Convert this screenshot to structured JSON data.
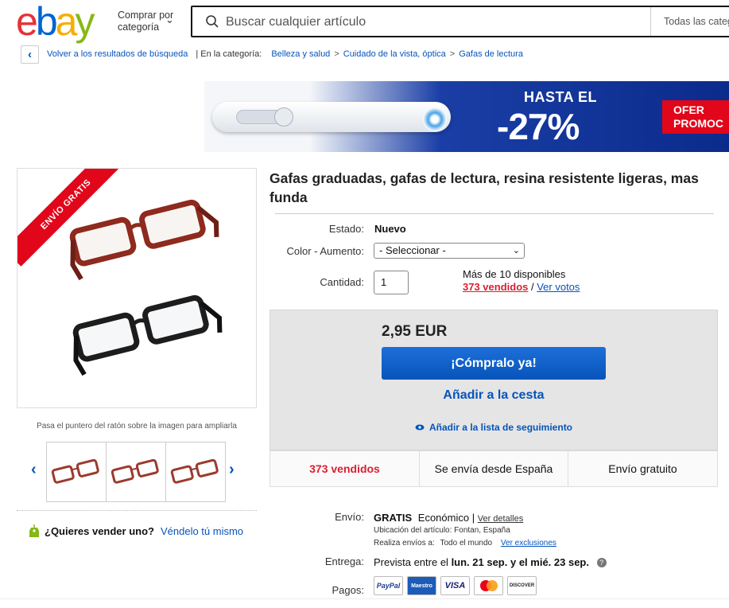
{
  "header": {
    "logo_letters": [
      "e",
      "b",
      "a",
      "y"
    ],
    "shop_by": "Comprar por categoría",
    "search_placeholder": "Buscar cualquier artículo",
    "category_select": "Todas las categ"
  },
  "breadcrumb": {
    "back_label": "Volver a los resultados de búsqueda",
    "in_category": "| En la categoría:",
    "items": [
      "Belleza y salud",
      "Cuidado de la vista, óptica",
      "Gafas de lectura"
    ],
    "separator": ">"
  },
  "banner": {
    "headline": "HASTA EL",
    "discount": "-27%",
    "offer_line1": "OFER",
    "offer_line2": "PROMOC"
  },
  "gallery": {
    "ribbon": "ENVÍO GRATIS",
    "zoom_hint": "Pasa el puntero del ratón sobre la imagen para ampliarla",
    "thumb_count": 3
  },
  "sell": {
    "question": "¿Quieres vender uno?",
    "link": "Véndelo tú mismo"
  },
  "product": {
    "title": "Gafas graduadas, gafas de lectura, resina resistente ligeras, mas funda",
    "condition_label": "Estado:",
    "condition_value": "Nuevo",
    "color_label": "Color - Aumento:",
    "color_value": "- Seleccionar -",
    "quantity_label": "Cantidad:",
    "quantity_value": "1",
    "available": "Más de 10 disponibles",
    "sold_link": "373 vendidos",
    "slash": " / ",
    "votes_link": "Ver votos"
  },
  "buybox": {
    "price": "2,95 EUR",
    "buy_now": "¡Cómpralo ya!",
    "add_to_cart": "Añadir a la cesta",
    "watchlist": "Añadir a la lista de seguimiento"
  },
  "infobar": {
    "sold": "373 vendidos",
    "ships_from": "Se envía desde España",
    "free_shipping": "Envío gratuito"
  },
  "shipping": {
    "label": "Envío:",
    "free": "GRATIS",
    "type": "Económico",
    "pipe": "|",
    "details_link": "Ver detalles",
    "location": "Ubicación del artículo: Fontan, España",
    "ships_to_label": "Realiza envíos a:",
    "ships_to_value": "Todo el mundo",
    "exclusions_link": "Ver exclusiones"
  },
  "delivery": {
    "label": "Entrega:",
    "prefix": "Prevista entre el",
    "dates": "lun. 21 sep. y el mié. 23 sep.",
    "help": "?"
  },
  "payments": {
    "label": "Pagos:",
    "methods": [
      "PayPal",
      "Maestro",
      "VISA",
      "MC",
      "DISCOVER"
    ]
  },
  "colors": {
    "link": "#0654ba",
    "sold_red": "#dd1e31",
    "buy_button": "#0654ba",
    "ribbon_red": "#e1061a"
  }
}
